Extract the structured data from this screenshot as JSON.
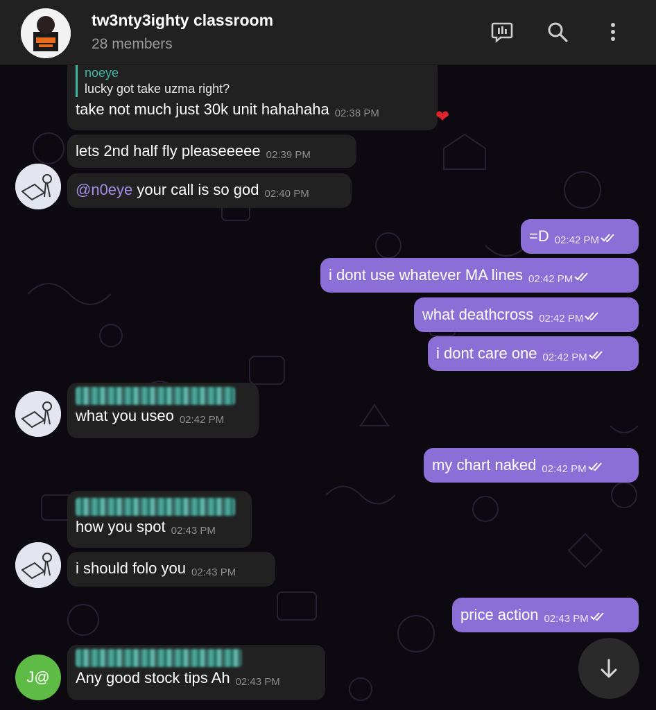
{
  "header": {
    "title": "tw3nty3ighty classroom",
    "subtitle": "28 members",
    "actions": [
      "poll-icon",
      "search-icon",
      "more-vertical-icon"
    ]
  },
  "messages": [
    {
      "direction": "in",
      "reply_name": "noeye",
      "reply_text": "lucky got take uzma right?",
      "text": "take not much just 30k unit hahahaha",
      "time": "02:38 PM",
      "reaction": "❤️"
    },
    {
      "direction": "in",
      "text": "lets 2nd half fly pleaseeeee",
      "time": "02:39 PM"
    },
    {
      "direction": "in",
      "mention": "@n0eye",
      "text": " your call is so god",
      "time": "02:40 PM"
    },
    {
      "direction": "out",
      "text": "=D",
      "time": "02:42 PM"
    },
    {
      "direction": "out",
      "text": "i dont use whatever MA lines",
      "time": "02:42 PM"
    },
    {
      "direction": "out",
      "text": "what deathcross",
      "time": "02:42 PM"
    },
    {
      "direction": "out",
      "text": "i dont care one",
      "time": "02:42 PM"
    },
    {
      "direction": "in",
      "text": "what you useo",
      "time": "02:42 PM"
    },
    {
      "direction": "out",
      "text": "my chart naked",
      "time": "02:42 PM"
    },
    {
      "direction": "in",
      "text": "how you spot",
      "time": "02:43 PM"
    },
    {
      "direction": "in",
      "text": "i should folo you",
      "time": "02:43 PM"
    },
    {
      "direction": "out",
      "text": "price action",
      "time": "02:43 PM"
    },
    {
      "direction": "in",
      "text": "Any good stock tips Ah",
      "time": "02:43 PM",
      "avatar_initials": "J@"
    }
  ],
  "colors": {
    "header_bg": "#212121",
    "incoming_bubble": "#212121",
    "outgoing_bubble": "#8b6ed6",
    "reply_accent": "#3fb8a4",
    "mention": "#a38fe8",
    "avatar_j": "#5dbb46"
  }
}
